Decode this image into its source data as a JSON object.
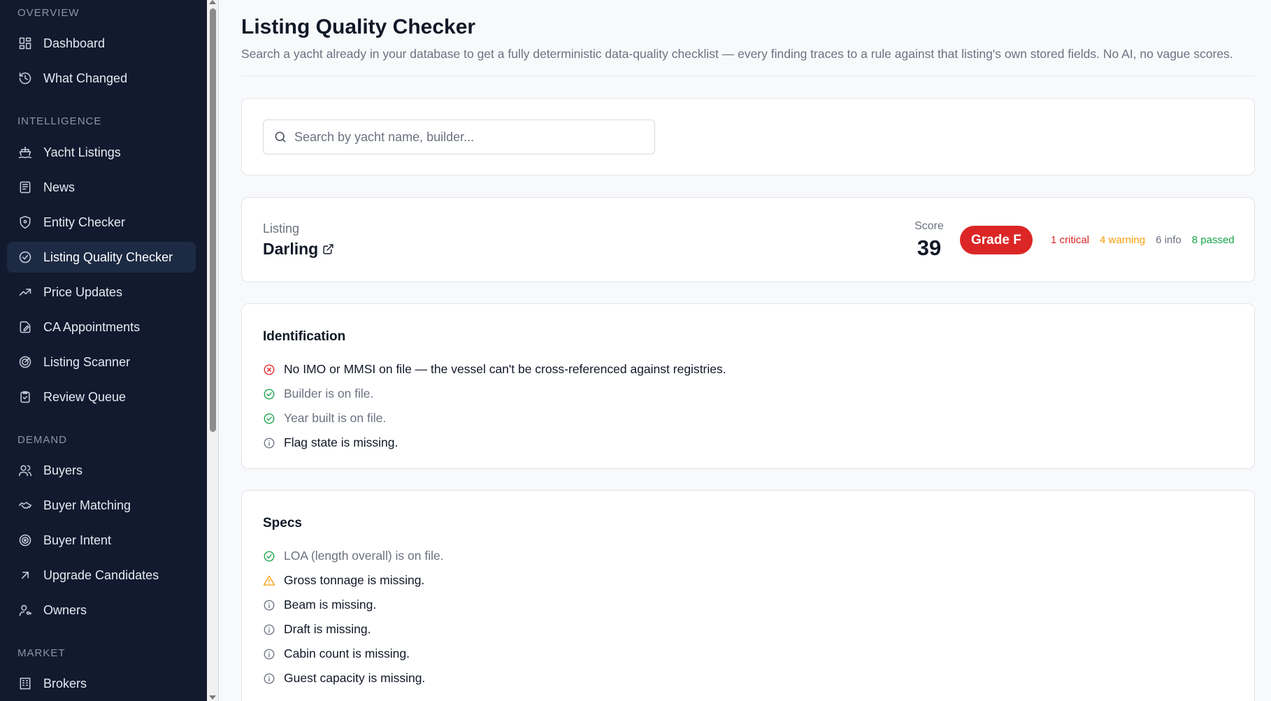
{
  "sidebar": {
    "sections": [
      {
        "label": "OVERVIEW",
        "items": [
          {
            "label": "Dashboard",
            "icon": "dashboard-icon"
          },
          {
            "label": "What Changed",
            "icon": "history-icon"
          }
        ]
      },
      {
        "label": "INTELLIGENCE",
        "items": [
          {
            "label": "Yacht Listings",
            "icon": "ship-icon"
          },
          {
            "label": "News",
            "icon": "newspaper-icon"
          },
          {
            "label": "Entity Checker",
            "icon": "shield-icon"
          },
          {
            "label": "Listing Quality Checker",
            "icon": "check-circle-icon",
            "active": true
          },
          {
            "label": "Price Updates",
            "icon": "trending-up-icon"
          },
          {
            "label": "CA Appointments",
            "icon": "file-edit-icon"
          },
          {
            "label": "Listing Scanner",
            "icon": "radar-icon"
          },
          {
            "label": "Review Queue",
            "icon": "clipboard-check-icon"
          }
        ]
      },
      {
        "label": "DEMAND",
        "items": [
          {
            "label": "Buyers",
            "icon": "users-icon"
          },
          {
            "label": "Buyer Matching",
            "icon": "handshake-icon"
          },
          {
            "label": "Buyer Intent",
            "icon": "target-icon"
          },
          {
            "label": "Upgrade Candidates",
            "icon": "arrow-up-right-icon"
          },
          {
            "label": "Owners",
            "icon": "user-key-icon"
          }
        ]
      },
      {
        "label": "MARKET",
        "items": [
          {
            "label": "Brokers",
            "icon": "building-icon"
          }
        ]
      }
    ]
  },
  "header": {
    "title": "Listing Quality Checker",
    "subtitle": "Search a yacht already in your database to get a fully deterministic data-quality checklist — every finding traces to a rule against that listing's own stored fields. No AI, no vague scores."
  },
  "search": {
    "placeholder": "Search by yacht name, builder..."
  },
  "listing": {
    "label": "Listing",
    "name": "Darling",
    "score_label": "Score",
    "score": "39",
    "grade": "Grade F",
    "counts": {
      "critical": "1 critical",
      "warning": "4 warning",
      "info": "6 info",
      "passed": "8 passed"
    }
  },
  "sections": [
    {
      "title": "Identification",
      "findings": [
        {
          "status": "critical",
          "text": "No IMO or MMSI on file — the vessel can't be cross-referenced against registries."
        },
        {
          "status": "passed",
          "text": "Builder is on file."
        },
        {
          "status": "passed",
          "text": "Year built is on file."
        },
        {
          "status": "info",
          "text": "Flag state is missing."
        }
      ]
    },
    {
      "title": "Specs",
      "findings": [
        {
          "status": "passed",
          "text": "LOA (length overall) is on file."
        },
        {
          "status": "warning",
          "text": "Gross tonnage is missing."
        },
        {
          "status": "info",
          "text": "Beam is missing."
        },
        {
          "status": "info",
          "text": "Draft is missing."
        },
        {
          "status": "info",
          "text": "Cabin count is missing."
        },
        {
          "status": "info",
          "text": "Guest capacity is missing."
        }
      ]
    }
  ],
  "colors": {
    "sidebar_bg": "#111a2e",
    "critical": "#dc2626",
    "warning": "#f59e0b",
    "passed": "#16a34a",
    "info": "#6b7280"
  }
}
